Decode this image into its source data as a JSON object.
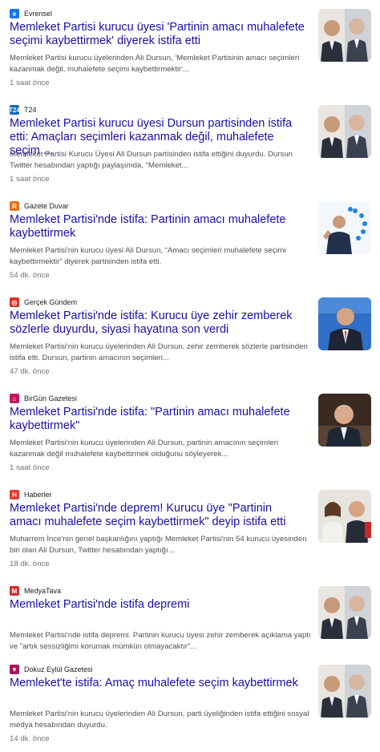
{
  "articles": [
    {
      "source": "Evrensel",
      "icon": "evrensel-logo-icon",
      "icon_color": "#1a73e8",
      "icon_glyph": "e",
      "title": "Memleket Partisi kurucu üyesi 'Partinin amacı muhalefete seçimi kaybettirmek' diyerek istifa etti",
      "snippet": "Memleket Partisi kurucu üyelerinden Ali Dursun, 'Memleket Partisinin amacı seçimleri kazanmak değil, muhalefete seçimi kaybettirmektir'...",
      "time": "1 saat önce",
      "thumb": "two-men-portrait"
    },
    {
      "source": "T24",
      "icon": "t24-logo-icon",
      "icon_color": "#1565c0",
      "icon_glyph": "T24",
      "title": "Memleket Partisi kurucu üyesi Dursun partisinden istifa etti: Amaçları seçimleri kazanmak değil, muhalefete seçim ...",
      "snippet": "Memleket Partisi Kurucu Üyesi Ali Dursun partisinden istifa ettiğini duyurdu. Dursun Twitter hesabından yaptığı paylaşımda, \"Memleket...",
      "time": "1 saat önce",
      "thumb": "two-men-portrait"
    },
    {
      "source": "Gazete Duvar",
      "icon": "gazete-duvar-logo-icon",
      "icon_color": "#e8711a",
      "icon_glyph": "R",
      "title": "Memleket Partisi'nde istifa: Partinin amacı muhalefete kaybettirmek",
      "snippet": "Memleket Partisi'nin kurucu üyesi Ali Dursun, “Amacı seçimleri muhalefete seçimi kaybettirmektir” diyerek partisinden istifa etti.",
      "time": "54 dk. önce",
      "thumb": "speaker-blue-logo"
    },
    {
      "source": "Gerçek Gündem",
      "icon": "gercek-gundem-logo-icon",
      "icon_color": "#d93025",
      "icon_glyph": "◎",
      "title": "Memleket Partisi'nde istifa: Kurucu üye zehir zemberek sözlerle duyurdu, siyasi hayatına son verdi",
      "snippet": "Memleket Partisi'nin kurucu üyelerinden Ali Dursun, zehir zemberek sözlerle partisinden istifa etti. Dursun, partinin amacının seçimleri...",
      "time": "47 dk. önce",
      "thumb": "man-blue-background"
    },
    {
      "source": "BirGün Gazetesi",
      "icon": "birgun-logo-icon",
      "icon_color": "#c2185b",
      "icon_glyph": "⌂",
      "title": "Memleket Partisi'nde istifa: \"Partinin amacı muhalefete kaybettirmek\"",
      "snippet": "Memleket Partisi'nin kurucu üyelerinden Ali Dursun, partinin amacının seçimleri kazanmak değil muhalefete kaybettirmek olduğunu söyleyerek...",
      "time": "1 saat önce",
      "thumb": "man-dark-background"
    },
    {
      "source": "Haberler",
      "icon": "haberler-logo-icon",
      "icon_color": "#e53935",
      "icon_glyph": "H",
      "title": "Memleket Partisi'nde deprem! Kurucu üye \"Partinin amacı muhalefete seçim kaybettirmek\" deyip istifa etti",
      "snippet": "Muharrem İnce'nin genel başkanlığını yaptığı Memleket Partisi'nin 54 kurucu üyesinden biri olan Ali Dursun, Twitter hesabından yaptığı...",
      "time": "18 dk. önce",
      "thumb": "woman-and-man"
    },
    {
      "source": "MedyaTava",
      "icon": "medyatava-logo-icon",
      "icon_color": "#d32f2f",
      "icon_glyph": "M",
      "title": "Memleket Partisi'nde istifa depremi",
      "snippet": "Memleket Partisi'nde istifa depremi. Partinin kurucu üyesi zehir zemberek açıklama yaptı ve \"artık sessizliğimi korumak mümkün olmayacaktır\"...",
      "time": "",
      "thumb": "two-men-portrait"
    },
    {
      "source": "Dokuz Eylül Gazetesi",
      "icon": "dokuz-eylul-logo-icon",
      "icon_color": "#ad1457",
      "icon_glyph": "▼",
      "title": "Memleket'te istifa: Amaç muhalefete seçim kaybettirmek",
      "snippet": "Memleket Partisi'nin kurucu üyelerinden Ali Dursun, parti üyeliğinden istifa ettiğini sosyal medya hesabından duyurdu.",
      "time": "14 dk. önce",
      "thumb": "two-men-portrait"
    }
  ]
}
